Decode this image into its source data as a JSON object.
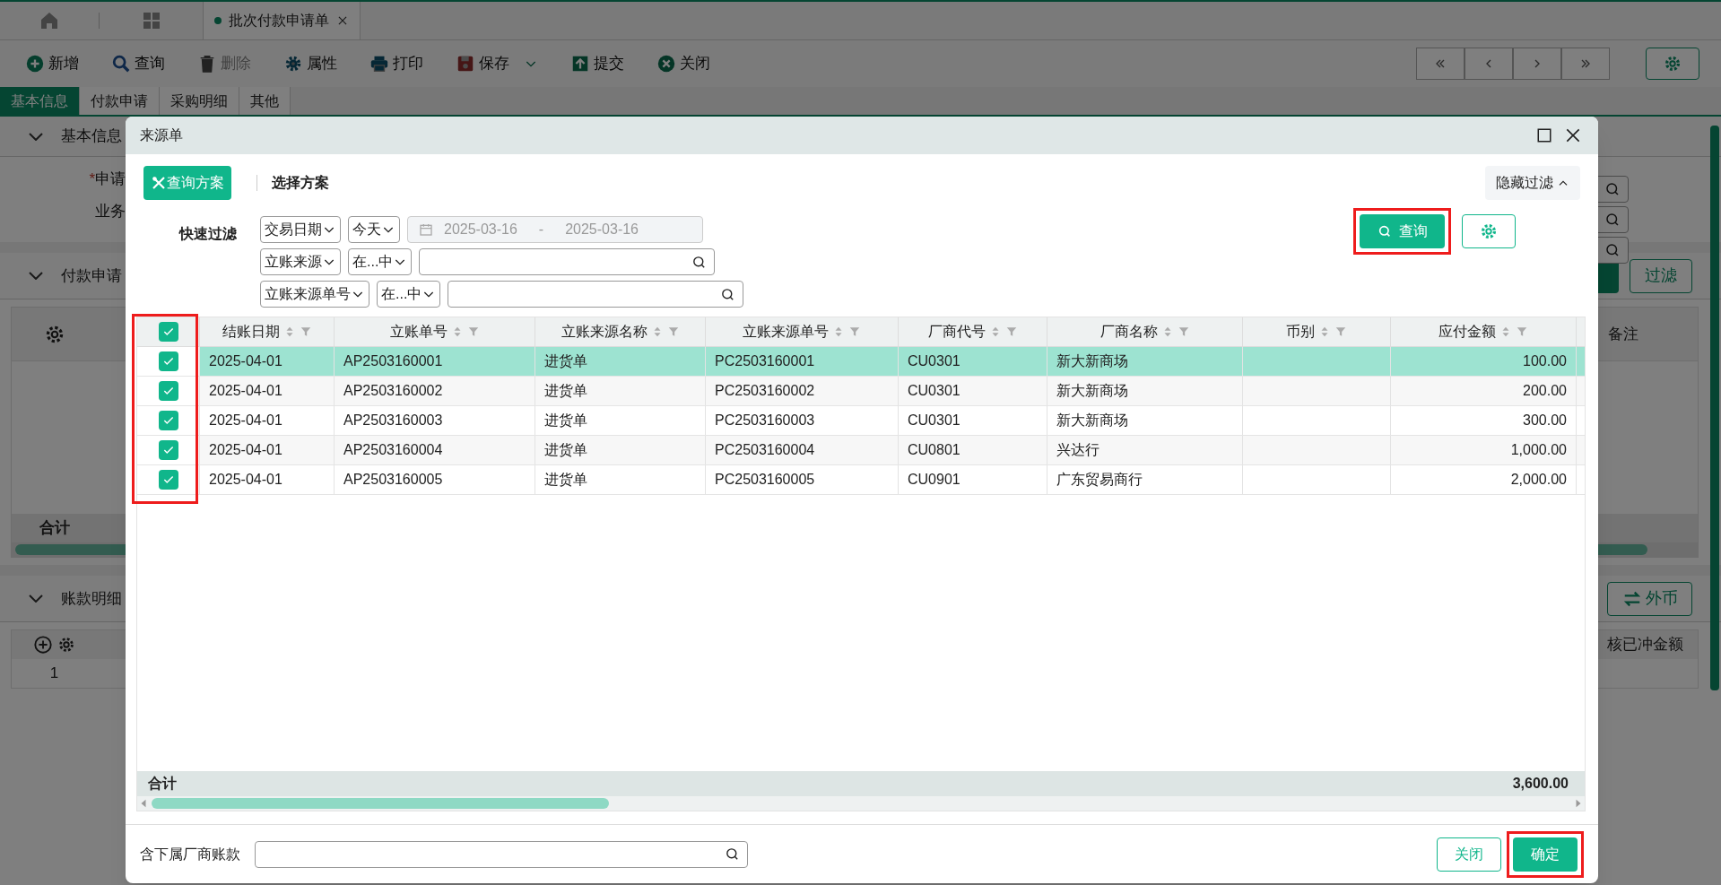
{
  "app_tabs": [
    {
      "label": "批次付款申请单",
      "selected": true
    }
  ],
  "toolbar": [
    {
      "label": "新增",
      "kind": "plus",
      "disabled": false
    },
    {
      "label": "查询",
      "kind": "search",
      "disabled": false
    },
    {
      "label": "删除",
      "kind": "trash",
      "disabled": true
    },
    {
      "label": "属性",
      "kind": "gear",
      "disabled": false
    },
    {
      "label": "打印",
      "kind": "printer",
      "disabled": false
    },
    {
      "label": "保存",
      "kind": "save",
      "disabled": false
    },
    {
      "label": "提交",
      "kind": "upload",
      "disabled": false
    },
    {
      "label": "关闭",
      "kind": "close",
      "disabled": false
    }
  ],
  "form_tabs": [
    {
      "label": "基本信息",
      "selected": true
    },
    {
      "label": "付款申请",
      "selected": false
    },
    {
      "label": "采购明细",
      "selected": false
    },
    {
      "label": "其他",
      "selected": false
    }
  ],
  "basic_info": {
    "title": "基本信息",
    "fields": [
      {
        "label": "申请",
        "required_mark": "*"
      },
      {
        "label": "业务"
      }
    ]
  },
  "payment_request": {
    "title": "付款申请",
    "filter_button": "过滤",
    "column": "备注",
    "total_label": "合计"
  },
  "account_details": {
    "title": "账款明细",
    "currency_button": "外币",
    "column": "核已冲金额",
    "row_number": "1"
  },
  "dialog": {
    "title": "来源单",
    "scheme_button": "查询方案",
    "scheme_label": "选择方案",
    "hide_filter": "隐藏过滤",
    "quick_filter_label": "快速过滤",
    "filters": [
      {
        "kind": "date_range",
        "field": "交易日期",
        "operator": "今天",
        "from": "2025-03-16",
        "separator": "-",
        "to": "2025-03-16"
      },
      {
        "kind": "lookup",
        "field": "立账来源",
        "operator": "在...中"
      },
      {
        "kind": "lookup",
        "field": "立账来源单号",
        "operator": "在...中"
      }
    ],
    "query_button": "查询",
    "columns": [
      "结账日期",
      "立账单号",
      "立账来源名称",
      "立账来源单号",
      "厂商代号",
      "厂商名称",
      "币别",
      "应付金额"
    ],
    "header_checked": true,
    "rows": [
      {
        "checked": true,
        "selected": true,
        "cells": [
          "2025-04-01",
          "AP2503160001",
          "进货单",
          "PC2503160001",
          "CU0301",
          "新大新商场",
          "",
          "100.00"
        ]
      },
      {
        "checked": true,
        "selected": false,
        "cells": [
          "2025-04-01",
          "AP2503160002",
          "进货单",
          "PC2503160002",
          "CU0301",
          "新大新商场",
          "",
          "200.00"
        ]
      },
      {
        "checked": true,
        "selected": false,
        "cells": [
          "2025-04-01",
          "AP2503160003",
          "进货单",
          "PC2503160003",
          "CU0301",
          "新大新商场",
          "",
          "300.00"
        ]
      },
      {
        "checked": true,
        "selected": false,
        "cells": [
          "2025-04-01",
          "AP2503160004",
          "进货单",
          "PC2503160004",
          "CU0801",
          "兴达行",
          "",
          "1,000.00"
        ]
      },
      {
        "checked": true,
        "selected": false,
        "cells": [
          "2025-04-01",
          "AP2503160005",
          "进货单",
          "PC2503160005",
          "CU0901",
          "广东贸易商行",
          "",
          "2,000.00"
        ]
      }
    ],
    "totals": {
      "label": "合计",
      "amount": "3,600.00"
    },
    "footer_label": "含下属厂商账款",
    "close_button": "关闭",
    "confirm_button": "确定"
  }
}
